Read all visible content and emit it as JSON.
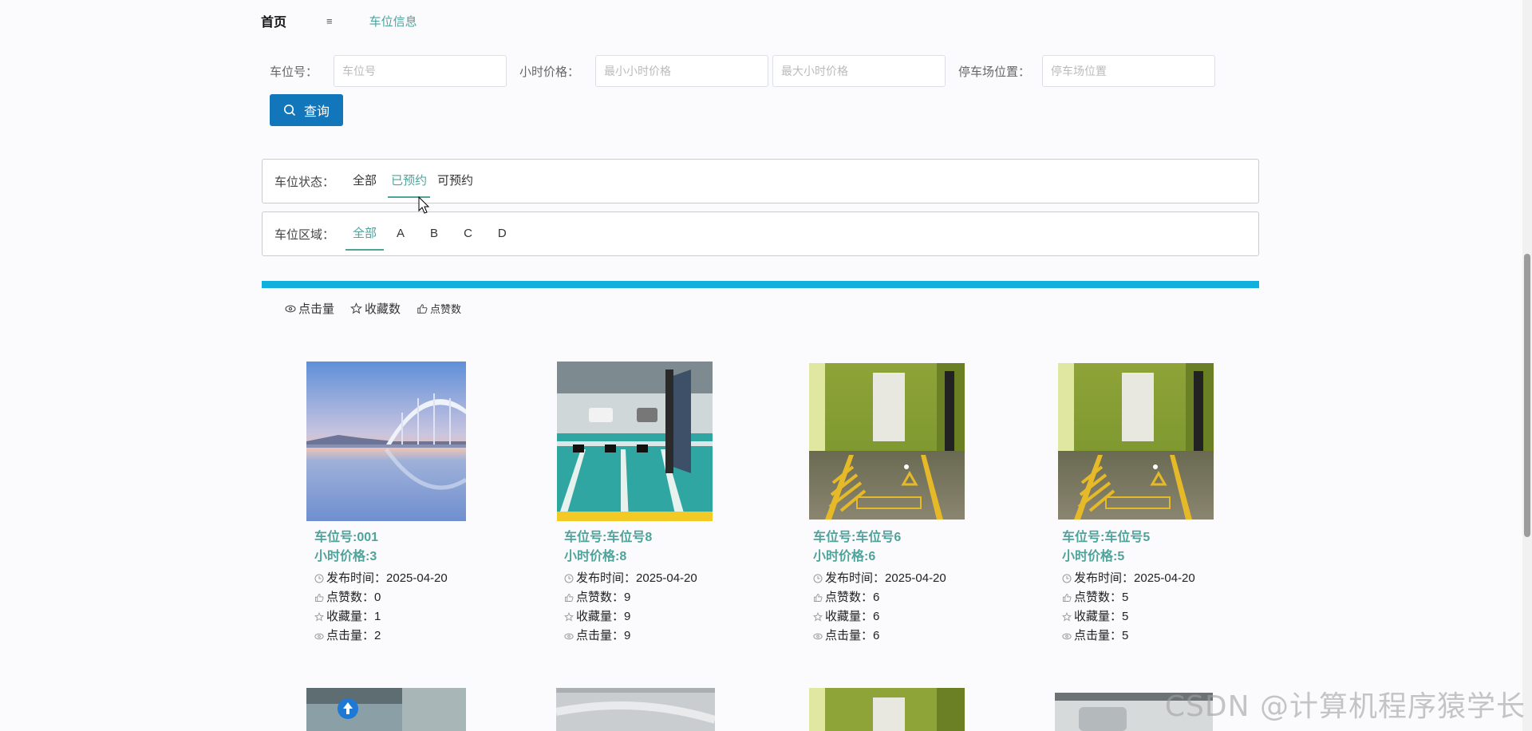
{
  "breadcrumb": {
    "home": "首页",
    "separator": "≡",
    "current": "车位信息"
  },
  "search": {
    "space_no_label": "车位号：",
    "space_no_placeholder": "车位号",
    "price_label": "小时价格：",
    "min_price_placeholder": "最小小时价格",
    "max_price_placeholder": "最大小时价格",
    "location_label": "停车场位置：",
    "location_placeholder": "停车场位置",
    "query_label": "查询"
  },
  "status_filter": {
    "label": "车位状态：",
    "options": [
      "全部",
      "已预约",
      "可预约"
    ],
    "active": "已预约"
  },
  "area_filter": {
    "label": "车位区域：",
    "options": [
      "全部",
      "A",
      "B",
      "C",
      "D"
    ],
    "active": "全部"
  },
  "sort": {
    "clicks": "点击量",
    "favorites": "收藏数",
    "likes": "点赞数"
  },
  "colors": {
    "accent": "#4fa39b",
    "button": "#1176ba",
    "bar": "#0fb0dd"
  },
  "cards": [
    {
      "title": "车位号:001",
      "price": "小时价格:3",
      "publish_label": "发布时间：",
      "publish": "2025-04-20",
      "likes_label": "点赞数：",
      "likes": "0",
      "fav_label": "收藏量：",
      "fav": "1",
      "clicks_label": "点击量：",
      "clicks": "2",
      "image": "lake-bridge"
    },
    {
      "title": "车位号:车位号8",
      "price": "小时价格:8",
      "publish_label": "发布时间：",
      "publish": "2025-04-20",
      "likes_label": "点赞数：",
      "likes": "9",
      "fav_label": "收藏量：",
      "fav": "9",
      "clicks_label": "点击量：",
      "clicks": "9",
      "image": "garage-teal"
    },
    {
      "title": "车位号:车位号6",
      "price": "小时价格:6",
      "publish_label": "发布时间：",
      "publish": "2025-04-20",
      "likes_label": "点赞数：",
      "likes": "6",
      "fav_label": "收藏量：",
      "fav": "6",
      "clicks_label": "点击量：",
      "clicks": "6",
      "image": "accessible-green"
    },
    {
      "title": "车位号:车位号5",
      "price": "小时价格:5",
      "publish_label": "发布时间：",
      "publish": "2025-04-20",
      "likes_label": "点赞数：",
      "likes": "5",
      "fav_label": "收藏量：",
      "fav": "5",
      "clicks_label": "点击量：",
      "clicks": "5",
      "image": "accessible-green"
    }
  ],
  "watermark": "CSDN @计算机程序猿学长"
}
